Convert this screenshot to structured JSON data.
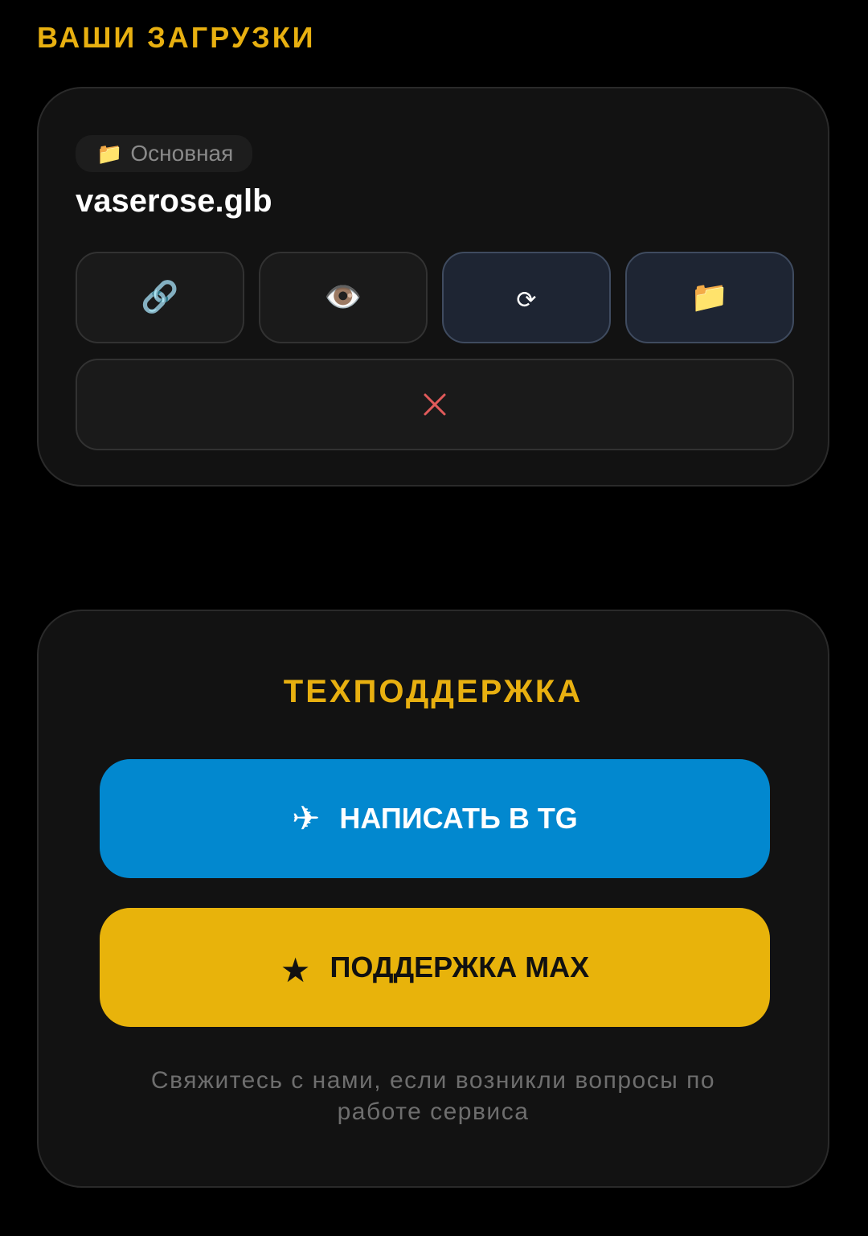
{
  "uploads": {
    "title": "ВАШИ ЗАГРУЗКИ",
    "item": {
      "folder_icon": "📁",
      "folder_label": "Основная",
      "file_name": "vaserose.glb",
      "actions": [
        {
          "icon": "🔗",
          "name": "link-icon"
        },
        {
          "icon": "👁️",
          "name": "eye-icon"
        },
        {
          "icon": "⟳",
          "name": "refresh-icon"
        },
        {
          "icon": "📁",
          "name": "folder-icon"
        }
      ],
      "delete_icon": "close-icon",
      "delete_color": "#E05A5A"
    }
  },
  "support": {
    "title": "ТЕХПОДДЕРЖКА",
    "tg_button": {
      "icon": "✈",
      "label": "НАПИСАТЬ В TG",
      "color": "#0288CF"
    },
    "max_button": {
      "icon": "★",
      "label": "ПОДДЕРЖКА MAX",
      "color": "#E8B30B"
    },
    "note": "Свяжитесь с нами, если возникли вопросы по работе сервиса"
  }
}
